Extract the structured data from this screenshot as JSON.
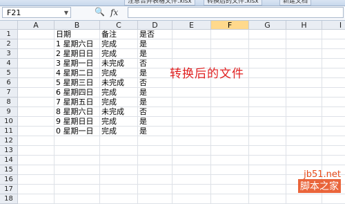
{
  "top_tabs": [
    "注意合并表格文件.xlsx",
    "转换后的文件.xlsx",
    "新建文档"
  ],
  "formula_bar": {
    "name_box": "F21",
    "zoom_icon": "zoom-icon",
    "fx_label": "fx",
    "value": ""
  },
  "columns": [
    "A",
    "B",
    "C",
    "D",
    "E",
    "F",
    "G",
    "H",
    "I"
  ],
  "selected_column": "F",
  "rows": [
    {
      "n": "1",
      "A": "",
      "B": "日期",
      "C": "备注",
      "D": "是否"
    },
    {
      "n": "2",
      "A": "",
      "B": "1 星期六日",
      "C": "完成",
      "D": "是"
    },
    {
      "n": "3",
      "A": "",
      "B": "2 星期日日",
      "C": "完成",
      "D": "是"
    },
    {
      "n": "4",
      "A": "",
      "B": "3 星期一日",
      "C": "未完成",
      "D": "否"
    },
    {
      "n": "5",
      "A": "",
      "B": "4 星期二日",
      "C": "完成",
      "D": "是"
    },
    {
      "n": "6",
      "A": "",
      "B": "5 星期三日",
      "C": "未完成",
      "D": "否"
    },
    {
      "n": "7",
      "A": "",
      "B": "6 星期四日",
      "C": "完成",
      "D": "是"
    },
    {
      "n": "8",
      "A": "",
      "B": "7 星期五日",
      "C": "完成",
      "D": "是"
    },
    {
      "n": "9",
      "A": "",
      "B": "8 星期六日",
      "C": "未完成",
      "D": "否"
    },
    {
      "n": "10",
      "A": "",
      "B": "9 星期日日",
      "C": "完成",
      "D": "是"
    },
    {
      "n": "11",
      "A": "",
      "B": "0 星期一日",
      "C": "完成",
      "D": "是"
    },
    {
      "n": "12",
      "A": "",
      "B": "",
      "C": "",
      "D": ""
    },
    {
      "n": "13",
      "A": "",
      "B": "",
      "C": "",
      "D": ""
    },
    {
      "n": "14",
      "A": "",
      "B": "",
      "C": "",
      "D": ""
    },
    {
      "n": "15",
      "A": "",
      "B": "",
      "C": "",
      "D": ""
    },
    {
      "n": "16",
      "A": "",
      "B": "",
      "C": "",
      "D": ""
    },
    {
      "n": "17",
      "A": "",
      "B": "",
      "C": "",
      "D": ""
    },
    {
      "n": "18",
      "A": "",
      "B": "",
      "C": "",
      "D": ""
    }
  ],
  "overlay_text": "转换后的文件",
  "watermark": {
    "site": "jb51.net",
    "brand": "脚本之家"
  },
  "colors": {
    "overlay": "#e02020",
    "selected_header": "#ffd98c",
    "watermark": "#e64a19"
  }
}
